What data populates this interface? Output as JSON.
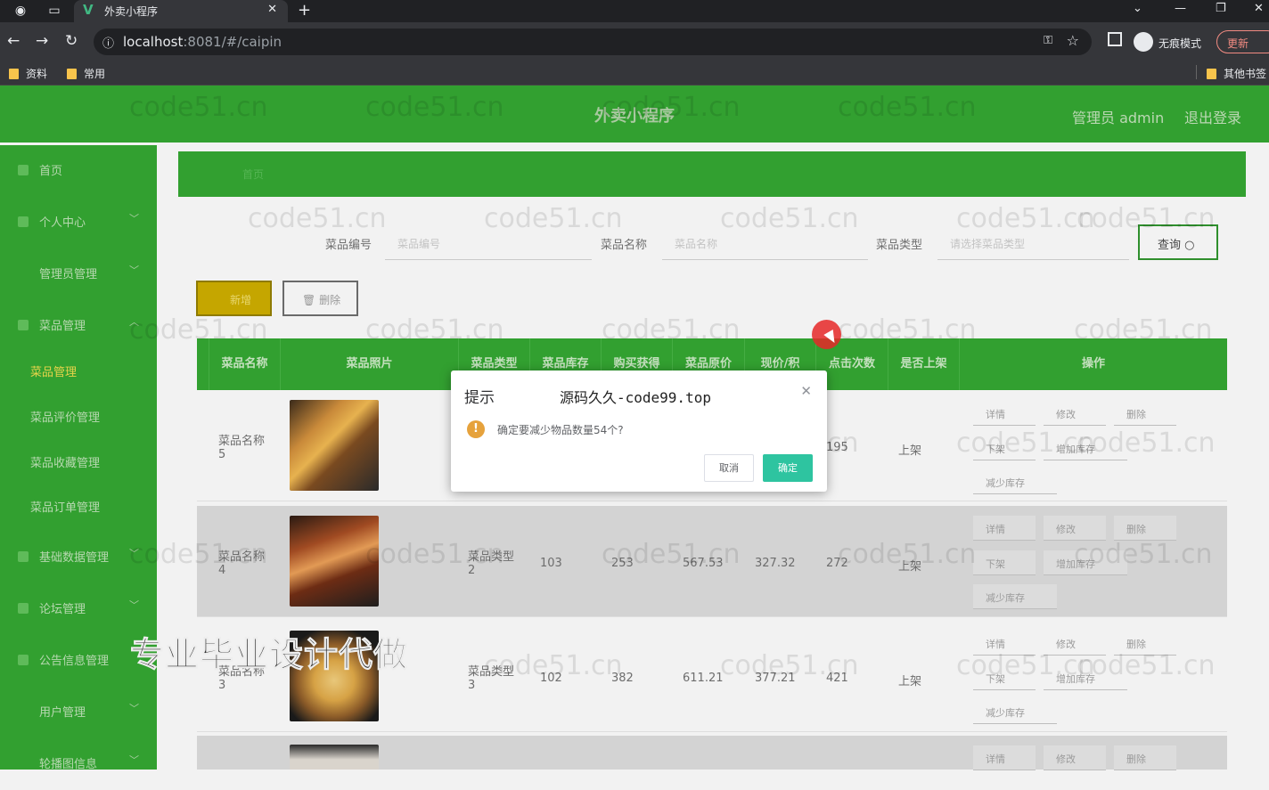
{
  "browser": {
    "tab_title": "外卖小程序",
    "url_host": "localhost",
    "url_rest": ":8081/#/caipin",
    "incognito_label": "无痕模式",
    "update_label": "更新",
    "bookmarks": [
      "资料",
      "常用"
    ],
    "other_bookmarks": "其他书签"
  },
  "header": {
    "title": "外卖小程序",
    "admin": "管理员 admin",
    "logout": "退出登录"
  },
  "sidebar": {
    "items": [
      {
        "label": "首页"
      },
      {
        "label": "个人中心"
      },
      {
        "label": "管理员管理"
      },
      {
        "label": "菜品管理"
      },
      {
        "label": "菜品管理"
      },
      {
        "label": "菜品评价管理"
      },
      {
        "label": "菜品收藏管理"
      },
      {
        "label": "菜品订单管理"
      },
      {
        "label": "基础数据管理"
      },
      {
        "label": "论坛管理"
      },
      {
        "label": "公告信息管理"
      },
      {
        "label": "用户管理"
      },
      {
        "label": "轮播图信息"
      }
    ]
  },
  "breadcrumb": "首页",
  "filters": {
    "code_label": "菜品编号",
    "code_placeholder": "菜品编号",
    "name_label": "菜品名称",
    "name_placeholder": "菜品名称",
    "type_label": "菜品类型",
    "type_placeholder": "请选择菜品类型",
    "query_label": "查询"
  },
  "actions": {
    "add_label": "新增",
    "delete_label": "删除"
  },
  "table": {
    "headers": [
      "菜品名称",
      "菜品照片",
      "菜品类型",
      "菜品库存",
      "购买获得",
      "菜品原价",
      "现价/积",
      "点击次数",
      "是否上架",
      "操作"
    ],
    "rows": [
      {
        "name": "菜品名称 5",
        "type": "",
        "stock": "",
        "points": "",
        "orig": "",
        "price": "",
        "clicks": "195",
        "status": "上架",
        "pic": "skewers"
      },
      {
        "name": "菜品名称 4",
        "type": "菜品类型 2",
        "stock": "103",
        "points": "253",
        "orig": "567.53",
        "price": "327.32",
        "clicks": "272",
        "status": "上架",
        "pic": "sandwich"
      },
      {
        "name": "菜品名称 3",
        "type": "菜品类型 3",
        "stock": "102",
        "points": "382",
        "orig": "611.21",
        "price": "377.21",
        "clicks": "421",
        "status": "上架",
        "pic": "noodles"
      },
      {
        "name": "",
        "type": "",
        "stock": "",
        "points": "",
        "orig": "",
        "price": "",
        "clicks": "",
        "status": "",
        "pic": "dish"
      }
    ],
    "row_actions": {
      "detail": "详情",
      "edit": "修改",
      "delete": "删除",
      "offshelf": "下架",
      "add_stock": "增加库存",
      "reduce_stock": "减少库存"
    }
  },
  "dialog": {
    "title": "提示",
    "brand": "源码久久-code99.top",
    "message": "确定要减少物品数量54个?",
    "cancel": "取消",
    "confirm": "确定"
  },
  "watermark": "code51.cn",
  "promo": "专业毕业设计代做",
  "colors": {
    "primary_green": "#32a030",
    "dialog_confirm": "#2ec4a0",
    "warning": "#e6a23c",
    "add_button": "#c5a600"
  }
}
